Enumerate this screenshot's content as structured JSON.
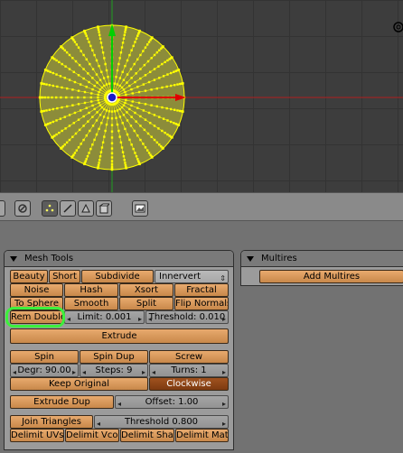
{
  "viewport": {
    "axis_colors": {
      "x": "#e00000",
      "y": "#00c000",
      "mesh": "#ffff00",
      "center": "#0000cc"
    }
  },
  "header_icons": [
    {
      "name": "proportional-edit-icon"
    },
    {
      "name": "vertex-select-icon"
    },
    {
      "name": "edge-select-icon"
    },
    {
      "name": "face-select-icon"
    },
    {
      "name": "occlude-geometry-icon"
    },
    {
      "name": "render-preview-icon"
    }
  ],
  "mesh_tools": {
    "title": "Mesh Tools",
    "row1": {
      "beauty": "Beauty",
      "short": "Short",
      "subdivide": "Subdivide",
      "innervert": "Innervert"
    },
    "row2": {
      "noise": "Noise",
      "hash": "Hash",
      "xsort": "Xsort",
      "fractal": "Fractal"
    },
    "row3": {
      "to_sphere": "To Sphere",
      "smooth": "Smooth",
      "split": "Split",
      "flip_normals": "Flip Normals"
    },
    "row4": {
      "rem_double": "Rem Double",
      "limit": "Limit: 0.001",
      "threshold": "Threshold: 0.010"
    },
    "extrude": "Extrude",
    "row6": {
      "spin": "Spin",
      "spin_dup": "Spin Dup",
      "screw": "Screw"
    },
    "row7": {
      "degr": "Degr: 90.00",
      "steps": "Steps: 9",
      "turns": "Turns: 1"
    },
    "row8": {
      "keep_original": "Keep Original",
      "clockwise": "Clockwise"
    },
    "row9": {
      "extrude_dup": "Extrude Dup",
      "offset": "Offset: 1.00"
    },
    "row10": {
      "join_triangles": "Join Triangles",
      "threshold": "Threshold 0.800"
    },
    "row11": {
      "delimit_uvs": "Delimit UVs",
      "delimit_vcol": "Delimit Vcol",
      "delimit_shar": "Delimit Shar",
      "delimit_mat": "Delimit Mat"
    }
  },
  "multires": {
    "title": "Multires",
    "add": "Add Multires"
  }
}
